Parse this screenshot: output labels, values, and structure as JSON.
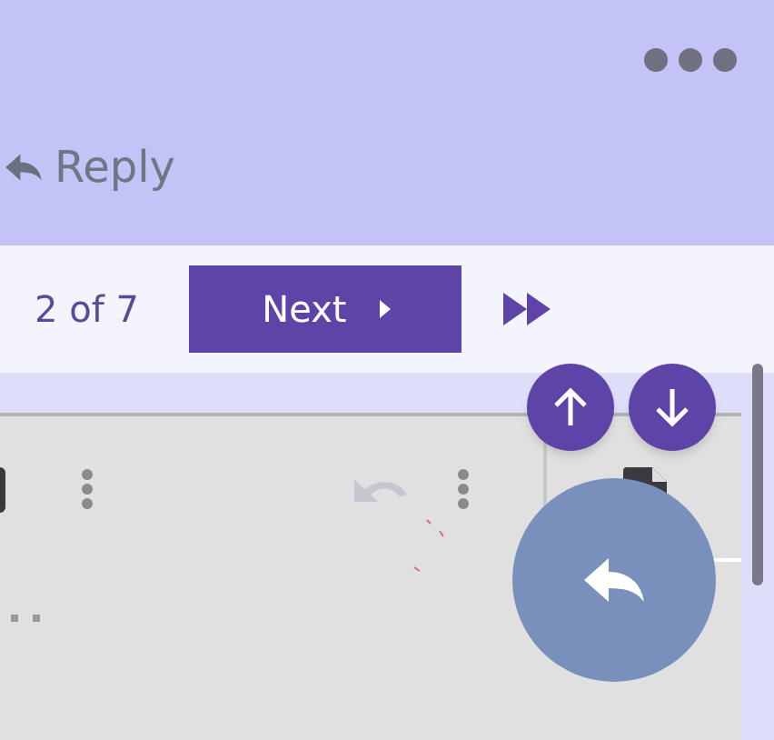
{
  "header": {
    "reply_label": "Reply"
  },
  "pager": {
    "position": "2 of 7",
    "next_label": "Next"
  }
}
